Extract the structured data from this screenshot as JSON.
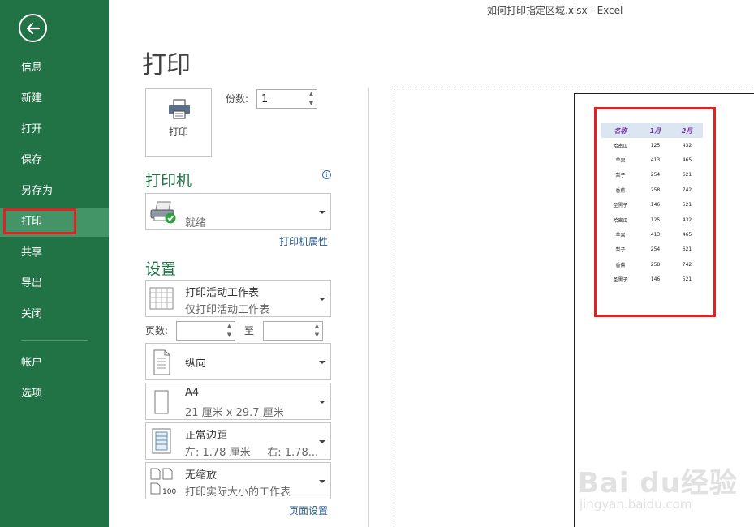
{
  "window": {
    "title": "如何打印指定区域.xlsx - Excel"
  },
  "sidebar": {
    "items": [
      {
        "label": "信息"
      },
      {
        "label": "新建"
      },
      {
        "label": "打开"
      },
      {
        "label": "保存"
      },
      {
        "label": "另存为"
      },
      {
        "label": "打印"
      },
      {
        "label": "共享"
      },
      {
        "label": "导出"
      },
      {
        "label": "关闭"
      },
      {
        "label": "帐户"
      },
      {
        "label": "选项"
      }
    ],
    "active_item": "打印",
    "accent_color": "#217346"
  },
  "page": {
    "title": "打印"
  },
  "print_button": {
    "label": "打印",
    "icon": "printer-icon"
  },
  "copies": {
    "label": "份数:",
    "value": "1"
  },
  "printer": {
    "heading": "打印机",
    "status": "就绪",
    "properties_link": "打印机属性",
    "icon": "printer-ready-icon"
  },
  "settings": {
    "heading": "设置",
    "what_to_print": {
      "title": "打印活动工作表",
      "subtitle": "仅打印活动工作表",
      "icon": "sheet-grid-icon"
    },
    "pages": {
      "label": "页数:",
      "to_label": "至",
      "from": "",
      "to": ""
    },
    "orientation": {
      "title": "纵向",
      "icon": "portrait-page-icon"
    },
    "paper_size": {
      "title": "A4",
      "subtitle": "21 厘米 x 29.7 厘米",
      "icon": "paper-size-icon"
    },
    "margins": {
      "title": "正常边距",
      "subtitle": "左: 1.78 厘米     右: 1.78...",
      "icon": "margins-icon"
    },
    "scaling": {
      "title": "无缩放",
      "subtitle": "打印实际大小的工作表",
      "icon": "no-scaling-icon"
    },
    "page_setup_link": "页面设置"
  },
  "preview": {
    "headers": [
      "名称",
      "1月",
      "2月"
    ],
    "rows": [
      [
        "哈密瓜",
        "125",
        "432"
      ],
      [
        "苹果",
        "413",
        "465"
      ],
      [
        "梨子",
        "254",
        "621"
      ],
      [
        "香蕉",
        "258",
        "742"
      ],
      [
        "圣黑子",
        "146",
        "521"
      ],
      [
        "哈密瓜",
        "125",
        "432"
      ],
      [
        "苹果",
        "413",
        "465"
      ],
      [
        "梨子",
        "254",
        "621"
      ],
      [
        "香蕉",
        "258",
        "742"
      ],
      [
        "圣黑子",
        "146",
        "521"
      ]
    ]
  },
  "watermark": {
    "brand": "Bai du经验",
    "url": "jingyan.baidu.com"
  }
}
